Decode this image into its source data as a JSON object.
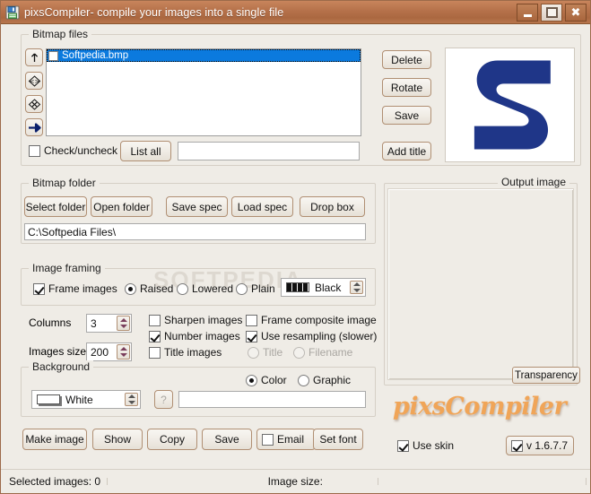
{
  "window": {
    "title": "pixsCompiler- compile your images into a single file",
    "icon": "save-disk-icon",
    "minimize_label": "Minimize",
    "maximize_label": "Maximize",
    "close_label": "Close",
    "titlebar_color": "#b5714a",
    "face_color": "#efece6"
  },
  "watermark": "SOFTPEDIA",
  "bitmap_files": {
    "caption": "Bitmap files",
    "tools": [
      {
        "name": "move-up-icon",
        "glyph": "↑"
      },
      {
        "name": "swap-icon",
        "glyph": "<>"
      },
      {
        "name": "delete-x-icon",
        "glyph": "✕"
      },
      {
        "name": "move-right-icon",
        "glyph": "➜"
      }
    ],
    "items": [
      {
        "label": "Softpedia.bmp",
        "checked": false,
        "selected": true
      }
    ],
    "check_uncheck_label": "Check/uncheck",
    "check_uncheck_checked": false,
    "list_all_label": "List all",
    "filter_value": "",
    "filter_placeholder": "",
    "actions": [
      {
        "label": "Delete",
        "name": "delete-button"
      },
      {
        "label": "Rotate",
        "name": "rotate-button"
      },
      {
        "label": "Save",
        "name": "save-image-button"
      },
      {
        "label": "Add title",
        "name": "add-title-button"
      }
    ],
    "preview_alt": "Softpedia S logo",
    "preview_color": "#1f3688",
    "selection_color": "#0b7ade"
  },
  "bitmap_folder": {
    "caption": "Bitmap folder",
    "buttons": [
      {
        "label": "Select folder",
        "name": "select-folder-button"
      },
      {
        "label": "Open folder",
        "name": "open-folder-button"
      },
      {
        "label": "Save spec",
        "name": "save-spec-button"
      },
      {
        "label": "Load spec",
        "name": "load-spec-button"
      },
      {
        "label": "Drop box",
        "name": "drop-box-button"
      }
    ],
    "path_value": "C:\\Softpedia Files\\",
    "path_placeholder": ""
  },
  "output_image": {
    "caption": "Output image",
    "transparency_label": "Transparency"
  },
  "image_framing": {
    "caption": "Image framing",
    "frame_images_label": "Frame images",
    "frame_images_checked": true,
    "style_options": [
      {
        "label": "Raised",
        "selected": true
      },
      {
        "label": "Lowered",
        "selected": false
      },
      {
        "label": "Plain",
        "selected": false
      }
    ],
    "frame_color_label": "Black",
    "frame_color_value": "#000000"
  },
  "settings": {
    "columns_label": "Columns",
    "columns_value": "3",
    "images_size_label": "Images size",
    "images_size_value": "200",
    "checks_col1": [
      {
        "label": "Sharpen images",
        "checked": false
      },
      {
        "label": "Number images",
        "checked": true
      },
      {
        "label": "Title images",
        "checked": false
      }
    ],
    "checks_col2": [
      {
        "label": "Frame composite image",
        "checked": false
      },
      {
        "label": "Use resampling (slower)",
        "checked": true
      }
    ],
    "label_source": [
      {
        "label": "Title",
        "selected": false,
        "disabled": true
      },
      {
        "label": "Filename",
        "selected": false,
        "disabled": true
      }
    ]
  },
  "background": {
    "caption": "Background",
    "mode_options": [
      {
        "label": "Color",
        "selected": true
      },
      {
        "label": "Graphic",
        "selected": false
      }
    ],
    "color_label": "White",
    "color_value": "#ffffff",
    "help_label": "?",
    "graphic_path_value": "",
    "graphic_path_placeholder": ""
  },
  "bottom_actions": [
    {
      "label": "Make image",
      "name": "make-image-button"
    },
    {
      "label": "Show",
      "name": "show-button"
    },
    {
      "label": "Copy",
      "name": "copy-button"
    },
    {
      "label": "Save",
      "name": "save-button"
    },
    {
      "label": "Set font",
      "name": "set-font-button"
    }
  ],
  "email": {
    "label": "Email",
    "checked": false
  },
  "branding": {
    "logo_text": "pixsCompiler",
    "logo_color": "#f0a558",
    "use_skin_label": "Use skin",
    "use_skin_checked": true,
    "version_label": "v 1.6.7.7",
    "version_checked": true
  },
  "status_bar": {
    "selected_images": "Selected images: 0",
    "image_size": "Image size:"
  }
}
